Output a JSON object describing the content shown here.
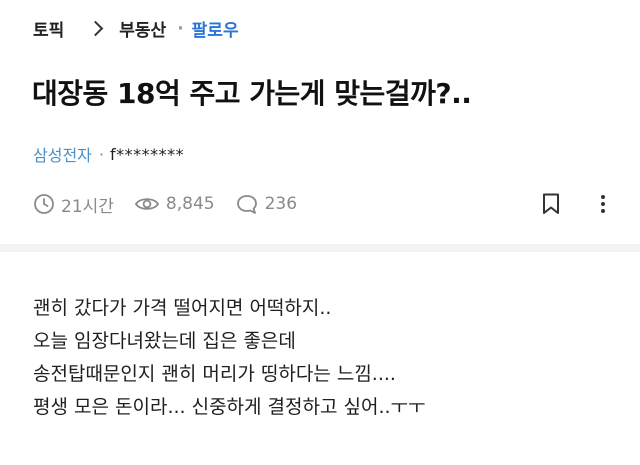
{
  "breadcrumb": {
    "section": "토픽",
    "category": "부동산",
    "follow_label": "팔로우"
  },
  "post": {
    "title": "대장동 18억 주고 가는게 맞는걸까?..",
    "author_company": "삼성전자",
    "author_separator": "·",
    "author_nickname": "f********",
    "time_ago": "21시간",
    "views": "8,845",
    "comments": "236",
    "body_lines": [
      "괜히 갔다가 가격 떨어지면 어떡하지..",
      "오늘 임장다녀왔는데 집은 좋은데",
      "송전탑때문인지 괜히 머리가 띵하다는 느낌....",
      "평생 모은 돈이라... 신중하게 결정하고 싶어..ㅜㅜ"
    ]
  },
  "icons": {
    "time": "clock-icon",
    "views": "eye-icon",
    "comments": "comment-bubble-icon",
    "bookmark": "bookmark-icon",
    "more": "more-vertical-icon"
  },
  "colors": {
    "follow": "#2a75d8",
    "company": "#4a90c7",
    "muted": "#8a8a8a",
    "divider": "#f2f3f5"
  }
}
